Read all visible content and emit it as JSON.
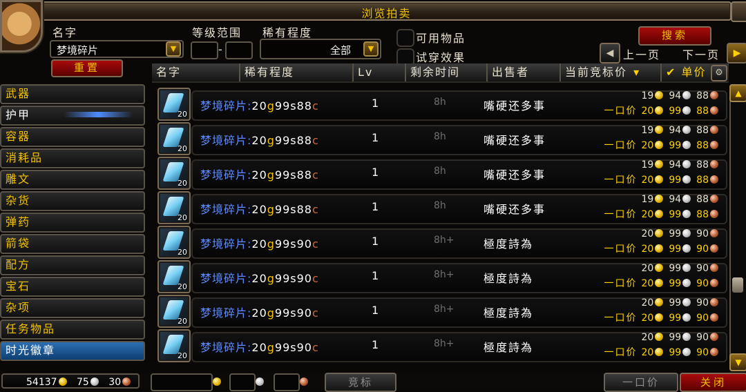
{
  "window": {
    "title": "浏览拍卖"
  },
  "search": {
    "name_label": "名字",
    "name_value": "梦境碎片",
    "level_label": "等级范围",
    "level_min": "",
    "level_max": "",
    "level_sep": "-",
    "rarity_label": "稀有程度",
    "rarity_value": "全部",
    "usable_label": "可用物品",
    "preview_label": "试穿效果",
    "search_button": "搜索",
    "reset_button": "重置",
    "prev_page": "上一页",
    "next_page": "下一页"
  },
  "columns": [
    "名字",
    "稀有程度",
    "Lv",
    "剩余时间",
    "出售者",
    "当前竞标价",
    "单价"
  ],
  "categories": [
    {
      "label": "武器"
    },
    {
      "label": "护甲"
    },
    {
      "label": "容器"
    },
    {
      "label": "消耗品"
    },
    {
      "label": "雕文"
    },
    {
      "label": "杂货"
    },
    {
      "label": "弹药"
    },
    {
      "label": "箭袋"
    },
    {
      "label": "配方"
    },
    {
      "label": "宝石"
    },
    {
      "label": "杂项"
    },
    {
      "label": "任务物品"
    },
    {
      "label": "时光徽章"
    }
  ],
  "listings": [
    {
      "name": "梦境碎片:",
      "price": [
        "20",
        "g",
        "99",
        "s",
        "88",
        "c"
      ],
      "count": "20",
      "lv": "1",
      "time": "8h",
      "seller": "嘴硬还多事",
      "bid": {
        "g": "19",
        "s": "94",
        "c": "88"
      },
      "buyout_label": "一口价",
      "buyout": {
        "g": "20",
        "s": "99",
        "c": "88"
      }
    },
    {
      "name": "梦境碎片:",
      "price": [
        "20",
        "g",
        "99",
        "s",
        "88",
        "c"
      ],
      "count": "20",
      "lv": "1",
      "time": "8h",
      "seller": "嘴硬还多事",
      "bid": {
        "g": "19",
        "s": "94",
        "c": "88"
      },
      "buyout_label": "一口价",
      "buyout": {
        "g": "20",
        "s": "99",
        "c": "88"
      }
    },
    {
      "name": "梦境碎片:",
      "price": [
        "20",
        "g",
        "99",
        "s",
        "88",
        "c"
      ],
      "count": "20",
      "lv": "1",
      "time": "8h",
      "seller": "嘴硬还多事",
      "bid": {
        "g": "19",
        "s": "94",
        "c": "88"
      },
      "buyout_label": "一口价",
      "buyout": {
        "g": "20",
        "s": "99",
        "c": "88"
      }
    },
    {
      "name": "梦境碎片:",
      "price": [
        "20",
        "g",
        "99",
        "s",
        "88",
        "c"
      ],
      "count": "20",
      "lv": "1",
      "time": "8h",
      "seller": "嘴硬还多事",
      "bid": {
        "g": "19",
        "s": "94",
        "c": "88"
      },
      "buyout_label": "一口价",
      "buyout": {
        "g": "20",
        "s": "99",
        "c": "88"
      }
    },
    {
      "name": "梦境碎片:",
      "price": [
        "20",
        "g",
        "99",
        "s",
        "90",
        "c"
      ],
      "count": "20",
      "lv": "1",
      "time": "8h+",
      "seller": "極度詩為",
      "bid": {
        "g": "20",
        "s": "99",
        "c": "90"
      },
      "buyout_label": "一口价",
      "buyout": {
        "g": "20",
        "s": "99",
        "c": "90"
      }
    },
    {
      "name": "梦境碎片:",
      "price": [
        "20",
        "g",
        "99",
        "s",
        "90",
        "c"
      ],
      "count": "20",
      "lv": "1",
      "time": "8h+",
      "seller": "極度詩為",
      "bid": {
        "g": "20",
        "s": "99",
        "c": "90"
      },
      "buyout_label": "一口价",
      "buyout": {
        "g": "20",
        "s": "99",
        "c": "90"
      }
    },
    {
      "name": "梦境碎片:",
      "price": [
        "20",
        "g",
        "99",
        "s",
        "90",
        "c"
      ],
      "count": "20",
      "lv": "1",
      "time": "8h+",
      "seller": "極度詩為",
      "bid": {
        "g": "20",
        "s": "99",
        "c": "90"
      },
      "buyout_label": "一口价",
      "buyout": {
        "g": "20",
        "s": "99",
        "c": "90"
      }
    },
    {
      "name": "梦境碎片:",
      "price": [
        "20",
        "g",
        "99",
        "s",
        "90",
        "c"
      ],
      "count": "20",
      "lv": "1",
      "time": "8h+",
      "seller": "極度詩為",
      "bid": {
        "g": "20",
        "s": "99",
        "c": "90"
      },
      "buyout_label": "一口价",
      "buyout": {
        "g": "20",
        "s": "99",
        "c": "90"
      }
    }
  ],
  "footer": {
    "money": {
      "g": "54137",
      "s": "75",
      "c": "30"
    },
    "bid_button": "竞标",
    "buyout_button": "一口价",
    "close_button": "关闭"
  },
  "icons": {
    "dropdown": "chevron-down-icon",
    "prev": "chevron-left-icon",
    "next": "chevron-right-icon",
    "sort": "arrow-down-icon",
    "check": "checkmark-icon",
    "gear": "gear-icon",
    "item": "dream-shard-icon"
  }
}
